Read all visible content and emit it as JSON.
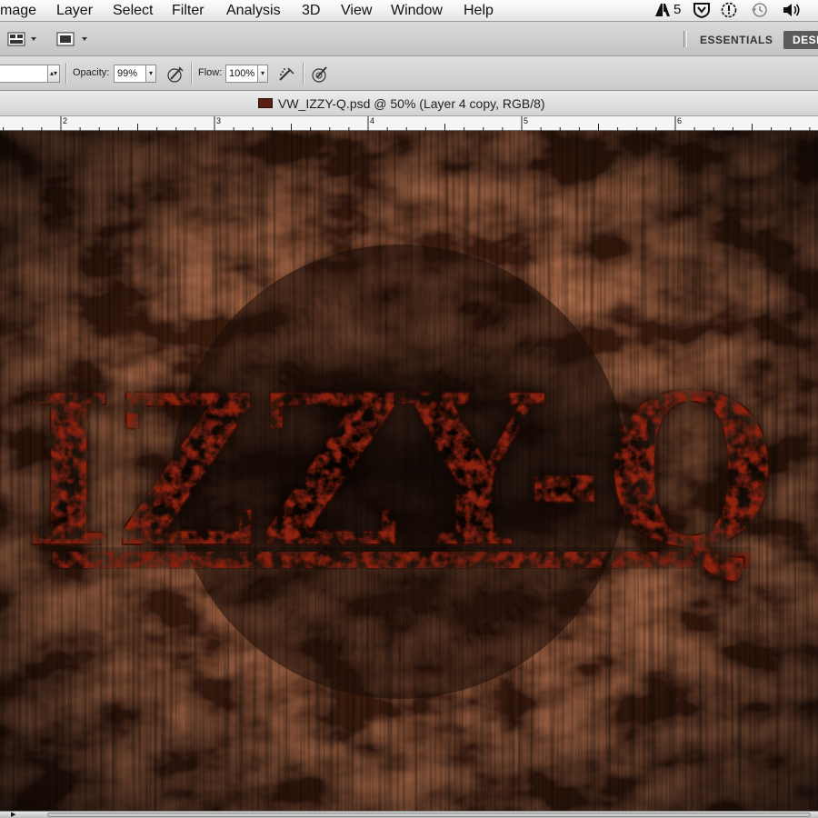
{
  "menubar": {
    "items": [
      "mage",
      "Layer",
      "Select",
      "Filter",
      "Analysis",
      "3D",
      "View",
      "Window",
      "Help"
    ],
    "status_adobe": "5"
  },
  "appbar": {
    "workspace_active": "ESSENTIALS",
    "workspace_next": "DESI"
  },
  "options": {
    "opacity_label": "Opacity:",
    "opacity_value": "99%",
    "flow_label": "Flow:",
    "flow_value": "100%"
  },
  "document": {
    "title": "VW_IZZY-Q.psd @ 50% (Layer 4 copy, RGB/8)"
  },
  "ruler": {
    "marks": [
      "2",
      "3",
      "4",
      "5",
      "6"
    ]
  },
  "artwork": {
    "logo_text": "IZZY-Q",
    "text_color": "#8a200f",
    "background_color": "#3a1a10"
  }
}
